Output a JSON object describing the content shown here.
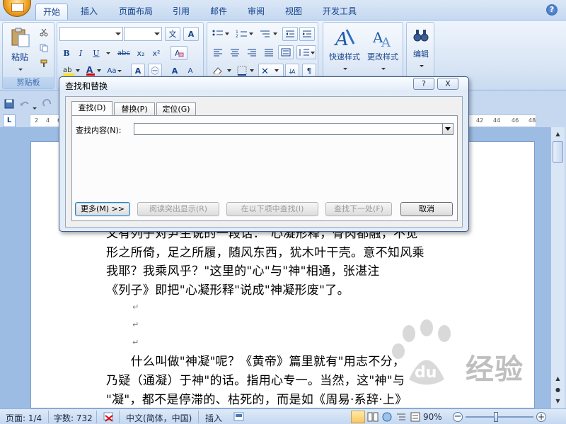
{
  "tabs": [
    "开始",
    "插入",
    "页面布局",
    "引用",
    "邮件",
    "审阅",
    "视图",
    "开发工具"
  ],
  "ribbon": {
    "clipboard": {
      "paste_label": "粘贴",
      "group_label": "剪贴板"
    },
    "styles": {
      "quick_styles_label": "快速样式",
      "change_styles_label": "更改样式"
    },
    "editing": {
      "edit_label": "编辑"
    },
    "font": {
      "bold": "B",
      "italic": "I",
      "underline": "U",
      "strike": "abc",
      "subscript": "x₂",
      "superscript": "x²",
      "font_color": "A",
      "grow": "A",
      "shrink": "A",
      "char_shade": "A",
      "aa": "Aa"
    },
    "help": "?"
  },
  "ruler": {
    "corner": "L",
    "left_numbers": [
      "2",
      "4",
      "6"
    ],
    "right_numbers": [
      "42",
      "44",
      "46",
      "48"
    ]
  },
  "dialog": {
    "title": "查找和替换",
    "help_btn": "?",
    "close_btn": "X",
    "tabs": [
      "查找(D)",
      "替换(P)",
      "定位(G)"
    ],
    "find_label": "查找内容(N):",
    "find_value": "",
    "buttons": {
      "more": "更多(M) >>",
      "highlight": "阅读突出显示(R)",
      "find_in": "在以下项中查找(I)",
      "find_next": "查找下一处(F)",
      "cancel": "取消"
    }
  },
  "document": {
    "lines": [
      "又有列子对尹生说的一段话：\"心凝形释，骨肉都融，不觉",
      "形之所倚，足之所履，随风东西，犹木叶干壳。意不知风乘",
      "我耶？我乘风乎？\"这里的\"心\"与\"神\"相通，张湛注",
      "《列子》即把\"心凝形释\"说成\"神凝形废\"了。",
      "",
      "",
      "",
      "　　什么叫做\"神凝\"呢？《黄帝》篇里就有\"用志不分，",
      "乃疑（通凝）于神\"的话。指用心专一。当然，这\"神\"与",
      "\"凝\"，都不是停滞的、枯死的，而是如《周易·系辞·上》"
    ],
    "para_mark": "↵"
  },
  "statusbar": {
    "page": "页面: 1/4",
    "words": "字数: 732",
    "language": "中文(简体，中国)",
    "insert_mode": "插入",
    "zoom": "90%"
  },
  "watermark": {
    "text": "经验"
  }
}
